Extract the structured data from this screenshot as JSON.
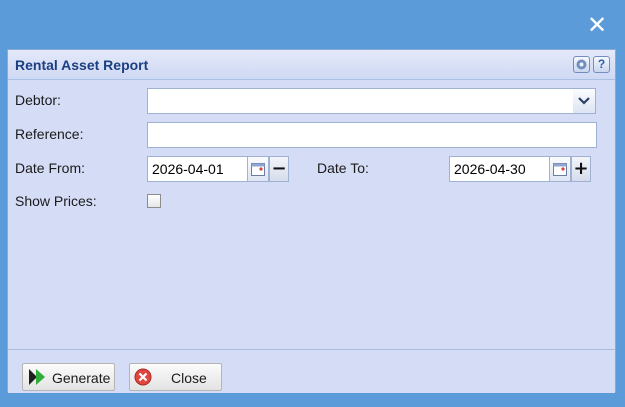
{
  "window": {
    "close_glyph": "✕"
  },
  "dialog": {
    "title": "Rental Asset Report",
    "tools": {
      "gear_icon": "gear-icon",
      "help_glyph": "?"
    }
  },
  "form": {
    "debtor": {
      "label": "Debtor:",
      "value": ""
    },
    "reference": {
      "label": "Reference:",
      "value": ""
    },
    "date_from": {
      "label": "Date From:",
      "value": "2026-04-01",
      "step_glyph": "−"
    },
    "date_to": {
      "label": "Date To:",
      "value": "2026-04-30",
      "step_glyph": "+"
    },
    "show_prices": {
      "label": "Show Prices:",
      "checked": false
    }
  },
  "footer": {
    "generate_label": "Generate",
    "close_label": "Close"
  },
  "colors": {
    "backdrop": "#5b9bd9",
    "dialog_bg": "#d5dcf6",
    "title_text": "#1c3f82"
  }
}
